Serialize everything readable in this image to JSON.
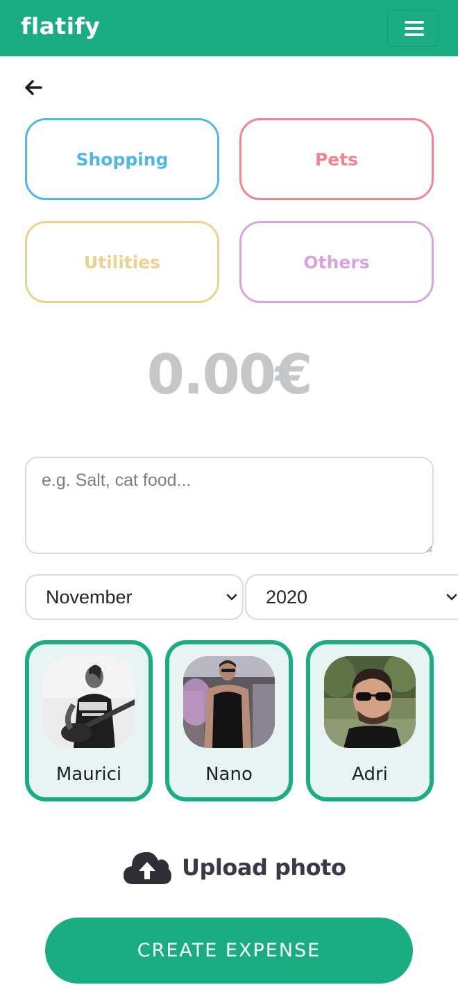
{
  "header": {
    "brand": "flatify",
    "menu_icon": "hamburger-menu-icon",
    "background": "#1aad84"
  },
  "back_icon": "arrow-left-icon",
  "categories": [
    {
      "label": "Shopping",
      "color": "#4fb7e2"
    },
    {
      "label": "Pets",
      "color": "#f2848f"
    },
    {
      "label": "Utilities",
      "color": "#ead38e"
    },
    {
      "label": "Others",
      "color": "#d8a5da"
    }
  ],
  "amount": "0.00€",
  "description": {
    "value": "",
    "placeholder": "e.g. Salt, cat food..."
  },
  "month": {
    "selected": "November"
  },
  "year": {
    "selected": "2020"
  },
  "members": [
    {
      "name": "Maurici"
    },
    {
      "name": "Nano"
    },
    {
      "name": "Adri"
    }
  ],
  "upload": {
    "label": "Upload photo",
    "icon": "cloud-upload-icon"
  },
  "create_button": {
    "label": "CREATE EXPENSE"
  },
  "colors": {
    "accent": "#1aad84",
    "member_bg": "#e7f4f2",
    "amount_text": "#c4c6c8"
  }
}
